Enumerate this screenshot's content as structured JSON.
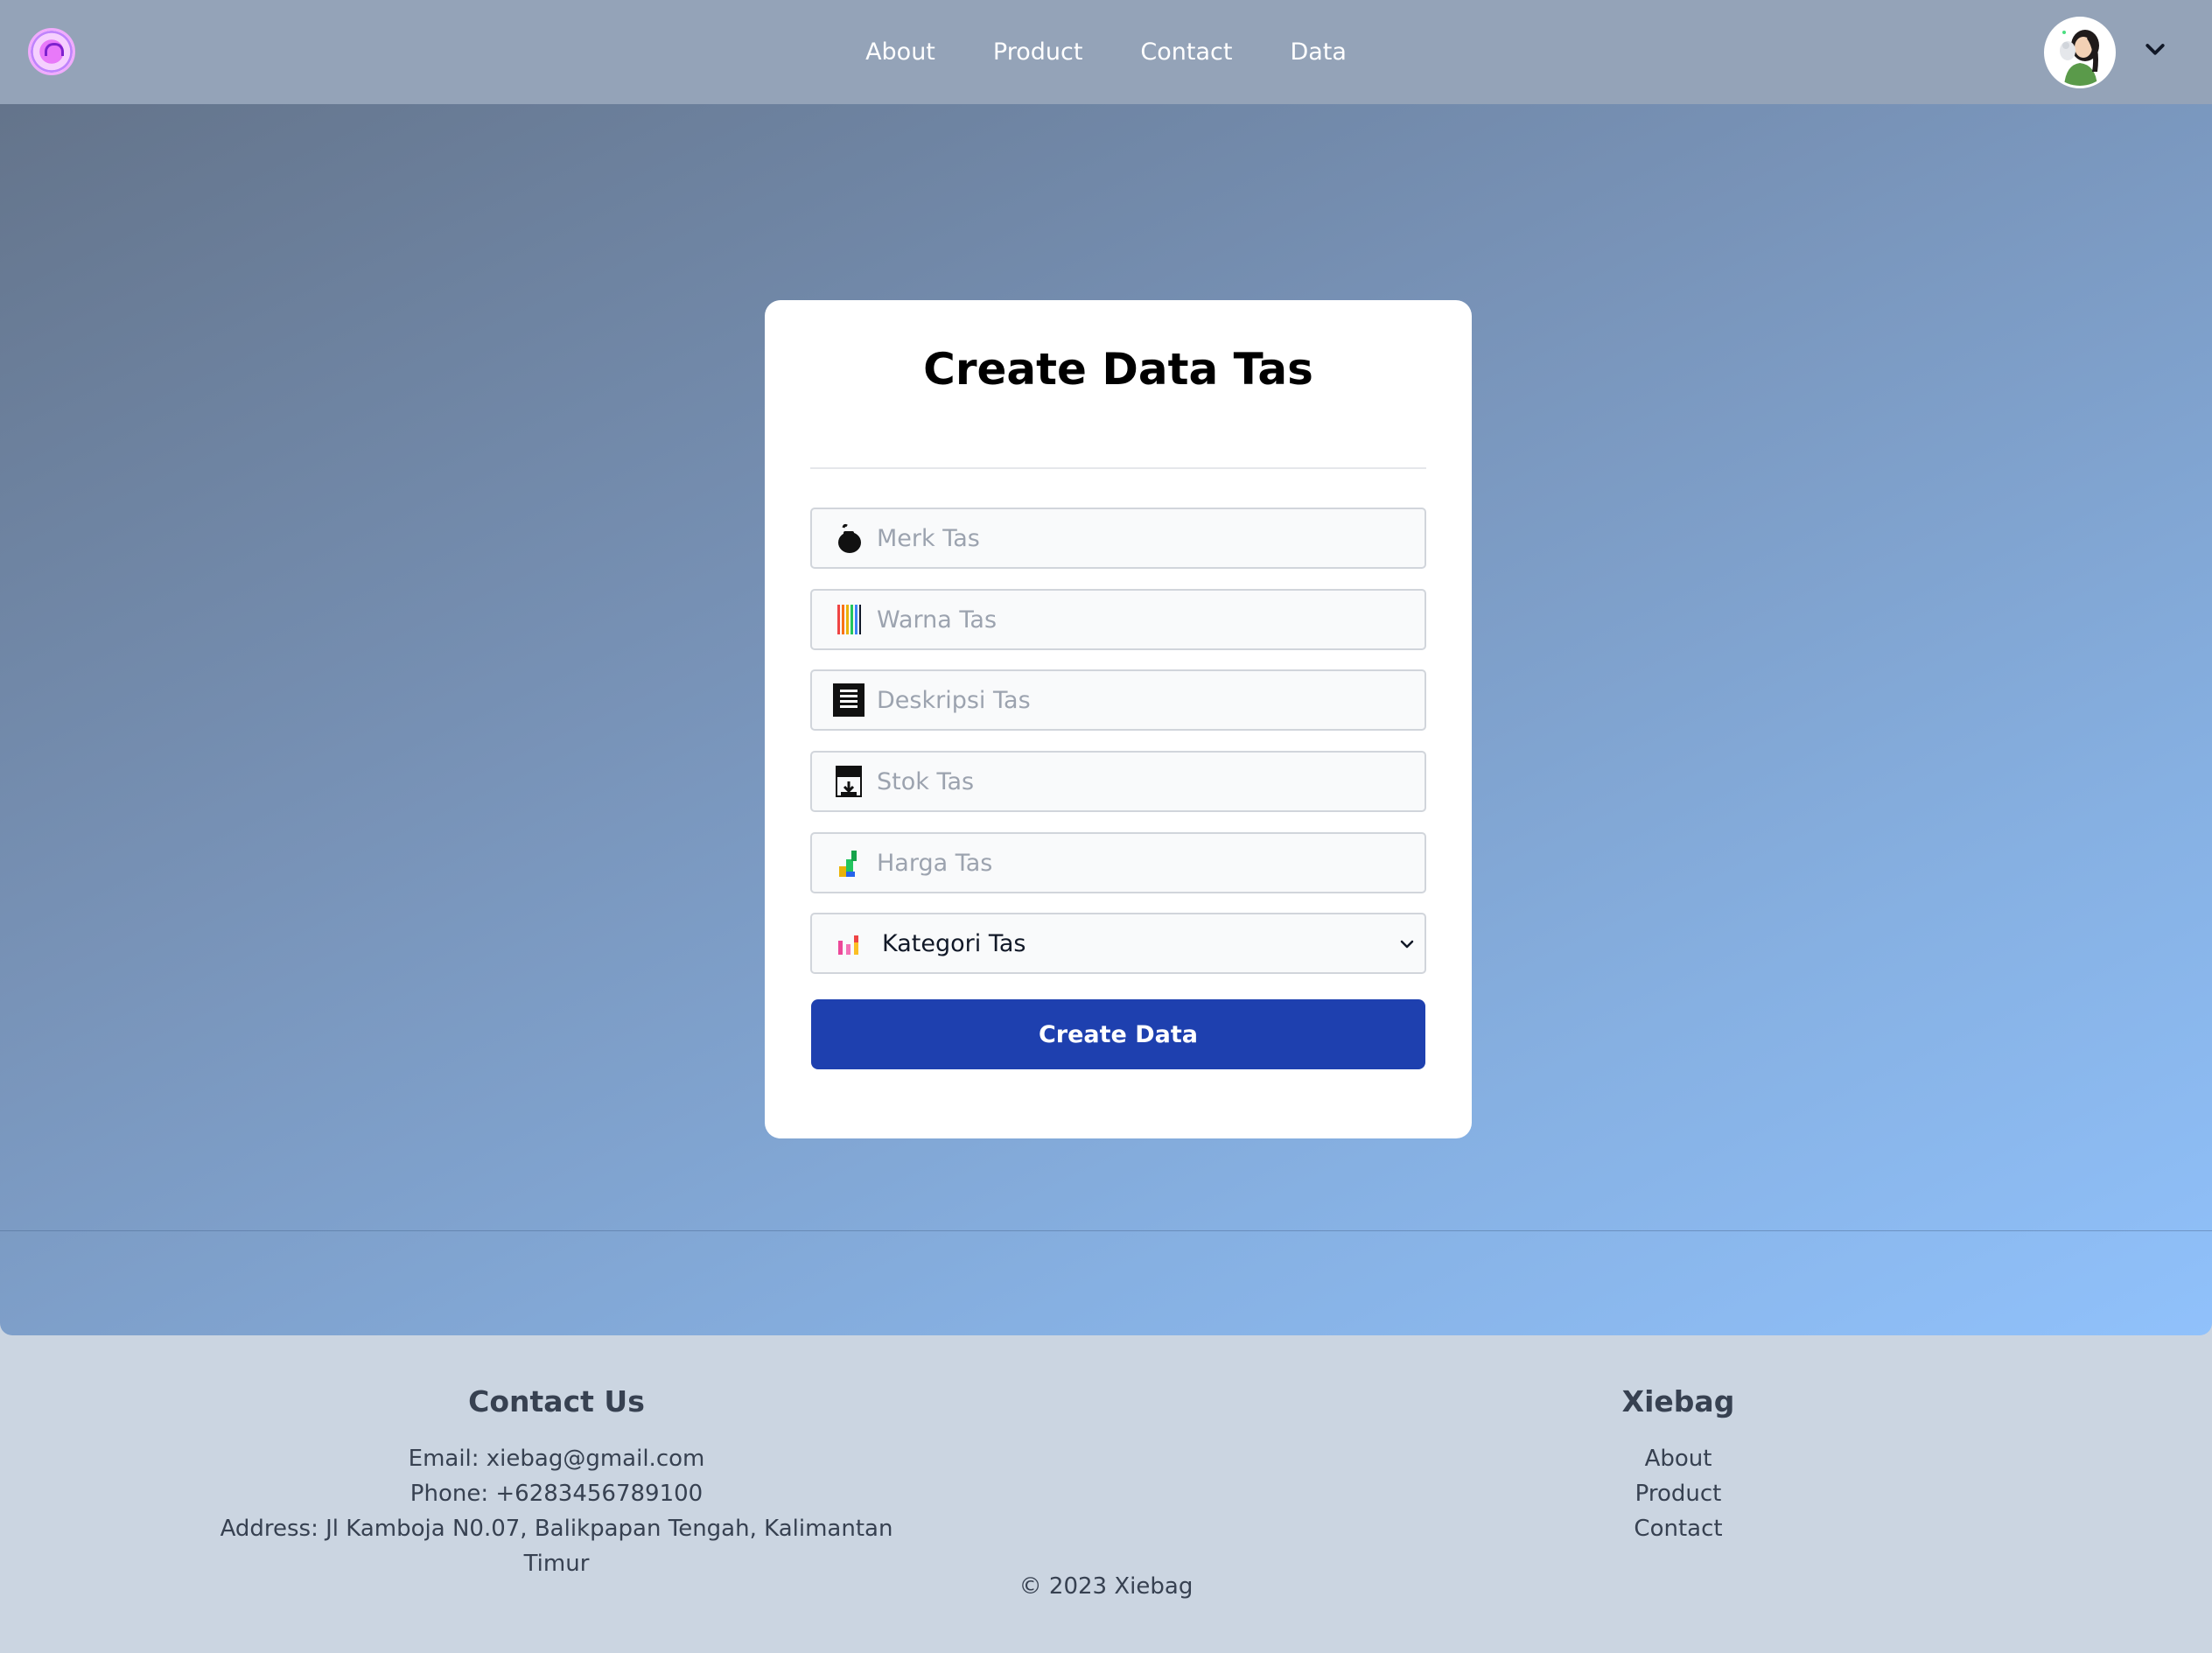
{
  "nav": {
    "links": [
      "About",
      "Product",
      "Contact",
      "Data"
    ]
  },
  "form": {
    "title": "Create Data Tas",
    "fields": {
      "merk": {
        "placeholder": "Merk Tas",
        "icon": "bag-icon"
      },
      "warna": {
        "placeholder": "Warna Tas",
        "icon": "color-swatch-icon"
      },
      "deskripsi": {
        "placeholder": "Deskripsi Tas",
        "icon": "document-icon"
      },
      "stok": {
        "placeholder": "Stok Tas",
        "icon": "inbox-tray-icon"
      },
      "harga": {
        "placeholder": "Harga Tas",
        "icon": "chart-up-icon"
      },
      "kategori": {
        "selected": "Kategori Tas",
        "icon": "bar-chart-icon"
      }
    },
    "submit_label": "Create Data"
  },
  "footer": {
    "contact": {
      "title": "Contact Us",
      "email": "Email: xiebag@gmail.com",
      "phone": "Phone: +6283456789100",
      "address": "Address: Jl Kamboja N0.07, Balikpapan Tengah, Kalimantan Timur"
    },
    "brand": {
      "title": "Xiebag",
      "links": [
        "About",
        "Product",
        "Contact"
      ]
    },
    "copyright": "© 2023 Xiebag"
  },
  "colors": {
    "navbar": "#94a3b8",
    "button": "#1e40af",
    "footer": "#cbd5e1"
  }
}
